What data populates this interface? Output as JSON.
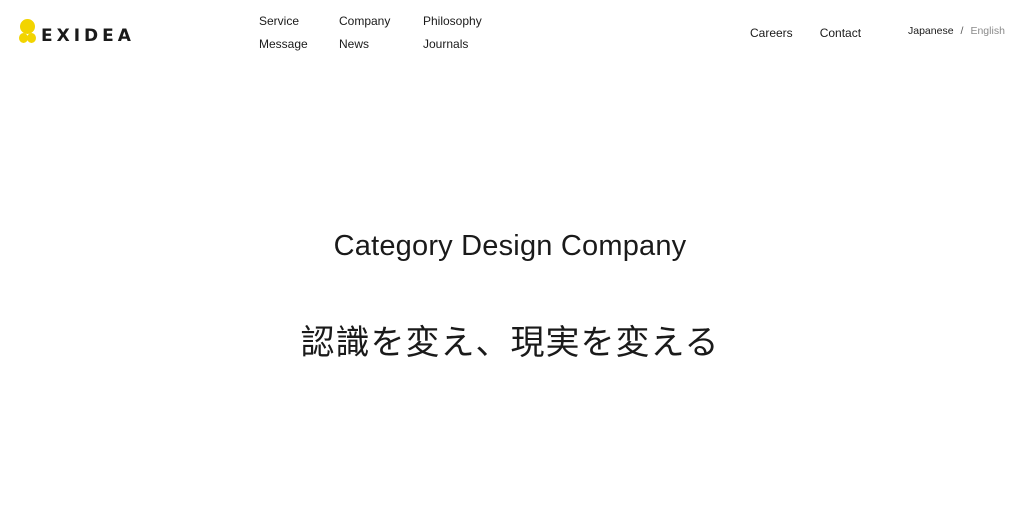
{
  "header": {
    "logo_text": "EXIDEA",
    "brand_color": "#f2d400",
    "nav": {
      "service": "Service",
      "company": "Company",
      "philosophy": "Philosophy",
      "message": "Message",
      "news": "News",
      "journals": "Journals",
      "careers": "Careers",
      "contact": "Contact"
    },
    "lang": {
      "japanese": "Japanese",
      "separator": "/",
      "english": "English"
    }
  },
  "hero": {
    "title": "Category Design Company",
    "subtitle": "認識を変え、現実を変える"
  }
}
